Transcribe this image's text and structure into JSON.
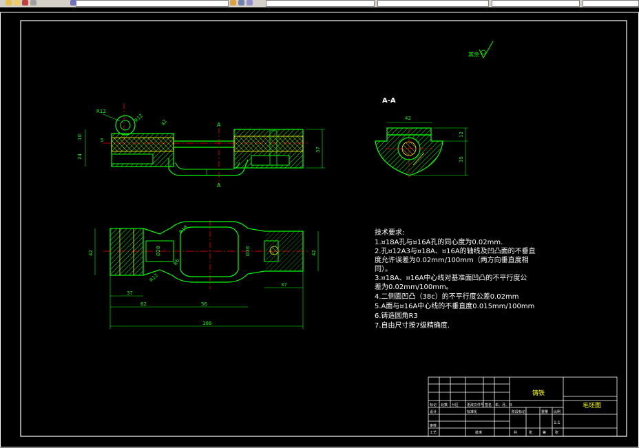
{
  "toolbar": {
    "icons": [
      "layer-icon",
      "sun-icon",
      "properties-icon"
    ],
    "fields": [
      "",
      "",
      ""
    ]
  },
  "drawing": {
    "roughness_label": "其余",
    "section_label": "A-A",
    "section_marker": "A",
    "dims": {
      "r12_top": "R12",
      "r12_right": "R12",
      "d42": "42",
      "d10": "10",
      "d5": "5",
      "d24": "24",
      "d37_h": "37",
      "d42_sec": "42",
      "d12": "12",
      "d35": "35",
      "d37_left": "37",
      "d62": "62",
      "d56": "56",
      "d186": "186",
      "d37_right": "37",
      "d42_left_v": "42",
      "d42_right_v": "42",
      "r18": "R18",
      "r12_b": "R12",
      "r6": "R6",
      "d36": "Ø36",
      "d28": "Ø28"
    },
    "notes_title": "技术要求:",
    "notes": [
      "1.¤18A孔与¤16A孔的同心度为0.02mm.",
      "2.孔¤12A3与¤18A、¤16A的轴线及凹凸面的不垂直",
      "度允许误差为0.02mm/100mm（两方向垂直度相",
      "同）。",
      "3.¤18A、¤16A中心线对基准面凹凸的不平行度公",
      "差为0.02mm/100mm。",
      "4.二侧面凹凸（38c）的不平行度公差0.02mm",
      "5.A面与¤16A中心线的不垂直度0.015mm/100mm",
      "6.铸造圆角R3",
      "7.自由尺寸按7级精确度."
    ],
    "title_block": {
      "material": "铸铁",
      "drawing_name": "毛坯图",
      "scale": "1:1",
      "row_labels_left": [
        "标记",
        "设计",
        "审核",
        "工艺"
      ],
      "header_cells": [
        "处数",
        "分区",
        "更改文件号",
        "签名",
        "年、月、日"
      ],
      "mid_cells": [
        "标准化",
        "阶段标记",
        "重量",
        "比例"
      ],
      "bottom_cells": [
        "共",
        "张",
        "第",
        "张"
      ],
      "approve": "批准"
    }
  },
  "colors": {
    "green": "#00ff00",
    "yellow": "#ffff00",
    "red": "#ff0000",
    "cyan": "#00ffff",
    "white": "#ffffff",
    "magenta": "#ff00ff"
  }
}
